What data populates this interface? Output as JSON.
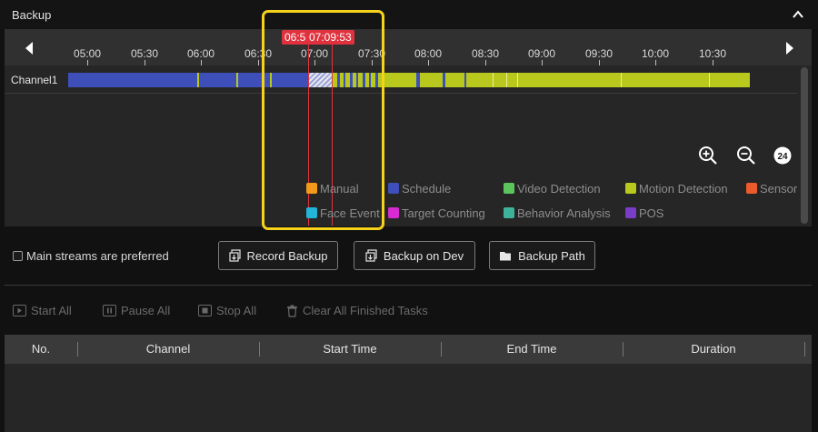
{
  "header": {
    "title": "Backup"
  },
  "timeline": {
    "ticks": [
      "05:00",
      "05:30",
      "06:00",
      "06:30",
      "07:00",
      "07:30",
      "08:00",
      "08:30",
      "09:00",
      "09:30",
      "10:00",
      "10:30"
    ],
    "channel": "Channel1",
    "cursor_tag_left": "06:5",
    "cursor_tag_right": "07:09:53"
  },
  "zoom": {
    "zoom_in": "zoom-in-icon",
    "zoom_out": "zoom-out-icon",
    "full_day_label": "24"
  },
  "legend": [
    {
      "label": "Manual",
      "color": "#f39a1b"
    },
    {
      "label": "Schedule",
      "color": "#3e4fb9"
    },
    {
      "label": "Video Detection",
      "color": "#5cc45c"
    },
    {
      "label": "Motion Detection",
      "color": "#b8c81c"
    },
    {
      "label": "Sensor",
      "color": "#ec5b2c"
    },
    {
      "label": "Face Event",
      "color": "#22b5d8"
    },
    {
      "label": "Target Counting",
      "color": "#d62bd0"
    },
    {
      "label": "Behavior Analysis",
      "color": "#3db39b"
    },
    {
      "label": "POS",
      "color": "#7a3dc8"
    }
  ],
  "options": {
    "main_streams": "Main streams are preferred"
  },
  "buttons": {
    "record_backup": "Record Backup",
    "backup_on_dev": "Backup on Dev",
    "backup_path": "Backup Path"
  },
  "toolbar": {
    "start_all": "Start All",
    "pause_all": "Pause All",
    "stop_all": "Stop All",
    "clear_finished": "Clear All Finished Tasks"
  },
  "table": {
    "columns": [
      "No.",
      "Channel",
      "Start Time",
      "End Time",
      "Duration"
    ]
  },
  "colors": {
    "schedule": "#3e4fb9",
    "motion": "#b8c81c",
    "cursor": "#e0323e",
    "highlight": "#f5d21c"
  }
}
